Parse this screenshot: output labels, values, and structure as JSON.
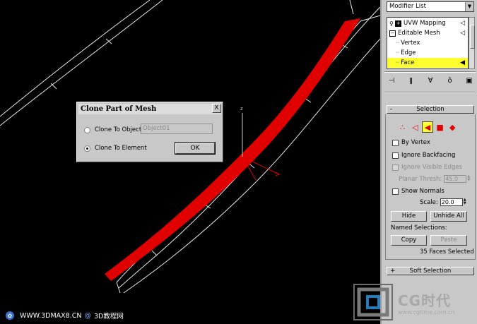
{
  "dialog": {
    "title": "Clone Part of Mesh",
    "close": "X",
    "opt_object": "Clone To Object:",
    "opt_element": "Clone To Element",
    "object_name": "Object01",
    "ok": "OK",
    "selected_option": "Clone To Element"
  },
  "panel": {
    "modifier_list": "Modifier List",
    "stack": {
      "uvw": "UVW Mapping",
      "mesh": "Editable Mesh",
      "vertex": "Vertex",
      "edge": "Edge",
      "face": "Face"
    },
    "selection": {
      "header": "Selection",
      "header_pm": "-",
      "by_vertex": "By Vertex",
      "ignore_backfacing": "Ignore Backfacing",
      "ignore_visible_edges": "Ignore Visible Edges",
      "planar_thresh_label": "Planar Thresh:",
      "planar_thresh_value": "45.0",
      "show_normals": "Show Normals",
      "scale_label": "Scale:",
      "scale_value": "20.0",
      "hide": "Hide",
      "unhide_all": "Unhide All",
      "named_selections": "Named Selections:",
      "copy": "Copy",
      "paste": "Paste",
      "status": "35 Faces Selected"
    },
    "soft_selection": {
      "header": "Soft Selection",
      "header_pm": "+"
    }
  },
  "viewport": {
    "gizmo_z": "z"
  },
  "watermark": {
    "left_site": "WWW.3DMAX8.CN",
    "left_at": "@",
    "left_name": "3D教程网",
    "cg_text": "CG时代",
    "cg_url": "www.cgtime.com.cn"
  },
  "colors": {
    "accent_red": "#e00000",
    "highlight_yellow": "#ffff30",
    "panel_gray": "#c8c8c8"
  }
}
